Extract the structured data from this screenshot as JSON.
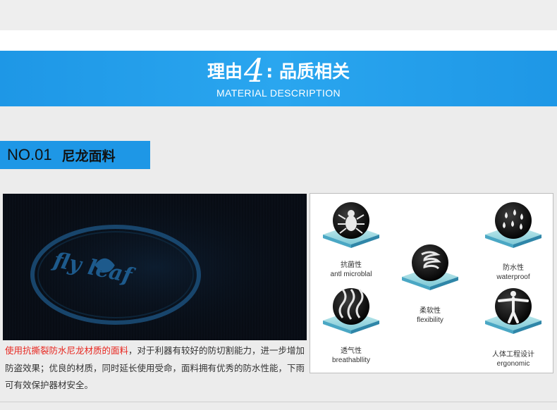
{
  "banner": {
    "title_prefix": "理由",
    "title_number": "4",
    "title_suffix": ": 品质相关",
    "subtitle": "MATERIAL DESCRIPTION"
  },
  "section": {
    "number": "NO.01",
    "name": "尼龙面料"
  },
  "fabric_image": {
    "logo_text": "fly leaf"
  },
  "description": {
    "highlight": "使用抗撕裂防水尼龙材质的面料",
    "rest": "，对于利器有较好的防切割能力，进一步增加防盗效果；优良的材质，同时延长使用受命，面料拥有优秀的防水性能，下雨可有效保护器材安全。"
  },
  "features": [
    {
      "cn": "抗菌性",
      "en": "antl microblal",
      "icon": "bug-icon"
    },
    {
      "cn": "防水性",
      "en": "waterproof",
      "icon": "water-drops-icon"
    },
    {
      "cn": "柔软性",
      "en": "flexibility",
      "icon": "spring-icon"
    },
    {
      "cn": "透气性",
      "en": "breathabllity",
      "icon": "vapor-icon"
    },
    {
      "cn": "人体工程设计",
      "en": "ergonomic",
      "icon": "human-figure-icon"
    }
  ]
}
